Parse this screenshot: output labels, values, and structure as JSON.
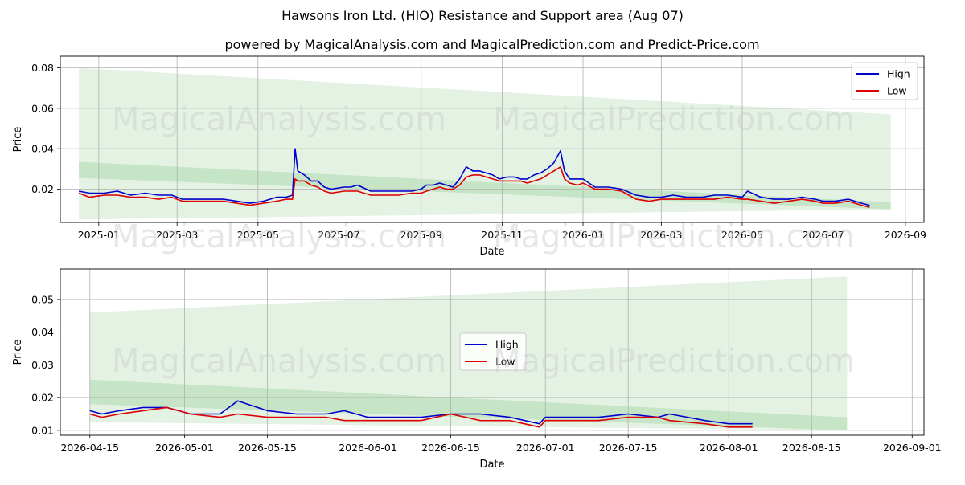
{
  "title": "Hawsons Iron Ltd. (HIO) Resistance and Support area (Aug 07)",
  "subtitle": "powered by MagicalAnalysis.com and MagicalPrediction.com and Predict-Price.com",
  "watermarks": [
    "MagicalAnalysis.com",
    "MagicalPrediction.com"
  ],
  "colors": {
    "high": "#0000cc",
    "low": "#dd0000",
    "band": "#2e9b2e",
    "grid": "#b0b0b0"
  },
  "chart_data": [
    {
      "type": "line",
      "xlabel": "Date",
      "ylabel": "Price",
      "xlim": [
        "2024-12-03",
        "2026-09-15"
      ],
      "ylim": [
        0.0035,
        0.0858
      ],
      "xticks": [
        "2025-01",
        "2025-03",
        "2025-05",
        "2025-07",
        "2025-09",
        "2025-11",
        "2026-01",
        "2026-03",
        "2026-05",
        "2026-07",
        "2026-09"
      ],
      "xtick_dates": [
        "2025-01-01",
        "2025-03-01",
        "2025-05-01",
        "2025-07-01",
        "2025-09-01",
        "2025-11-01",
        "2026-01-01",
        "2026-03-01",
        "2026-05-01",
        "2026-07-01",
        "2026-09-01"
      ],
      "yticks": [
        "0.02",
        "0.04",
        "0.06",
        "0.08"
      ],
      "grid": true,
      "legend": {
        "position": "top-right",
        "entries": [
          "High",
          "Low"
        ]
      },
      "bands": [
        {
          "x": [
            "2024-12-17",
            "2026-08-21"
          ],
          "upper": [
            0.08,
            0.057
          ],
          "lower": [
            0.005,
            0.01
          ]
        },
        {
          "x": [
            "2024-12-17",
            "2026-08-21"
          ],
          "upper": [
            0.0335,
            0.0135
          ],
          "lower": [
            0.0255,
            0.01
          ]
        }
      ],
      "series": [
        {
          "name": "High",
          "x": [
            "2024-12-17",
            "2024-12-25",
            "2025-01-05",
            "2025-01-15",
            "2025-01-25",
            "2025-02-05",
            "2025-02-15",
            "2025-02-25",
            "2025-03-05",
            "2025-03-15",
            "2025-03-25",
            "2025-04-05",
            "2025-04-15",
            "2025-04-25",
            "2025-05-05",
            "2025-05-15",
            "2025-05-22",
            "2025-05-27",
            "2025-05-29",
            "2025-05-31",
            "2025-06-05",
            "2025-06-10",
            "2025-06-15",
            "2025-06-20",
            "2025-06-25",
            "2025-07-05",
            "2025-07-10",
            "2025-07-15",
            "2025-07-25",
            "2025-08-05",
            "2025-08-15",
            "2025-08-25",
            "2025-09-01",
            "2025-09-05",
            "2025-09-10",
            "2025-09-15",
            "2025-09-20",
            "2025-09-25",
            "2025-09-30",
            "2025-10-05",
            "2025-10-10",
            "2025-10-15",
            "2025-10-20",
            "2025-10-25",
            "2025-10-30",
            "2025-11-05",
            "2025-11-10",
            "2025-11-15",
            "2025-11-20",
            "2025-11-25",
            "2025-11-30",
            "2025-12-05",
            "2025-12-10",
            "2025-12-15",
            "2025-12-18",
            "2025-12-22",
            "2025-12-28",
            "2026-01-01",
            "2026-01-10",
            "2026-01-20",
            "2026-01-30",
            "2026-02-10",
            "2026-02-20",
            "2026-03-01",
            "2026-03-10",
            "2026-03-20",
            "2026-04-01",
            "2026-04-10",
            "2026-04-20",
            "2026-05-01",
            "2026-05-05",
            "2026-05-15",
            "2026-05-25",
            "2026-06-05",
            "2026-06-15",
            "2026-06-25",
            "2026-07-01",
            "2026-07-10",
            "2026-07-20",
            "2026-07-30",
            "2026-08-05"
          ],
          "values": [
            0.019,
            0.018,
            0.018,
            0.019,
            0.017,
            0.018,
            0.017,
            0.017,
            0.015,
            0.015,
            0.015,
            0.015,
            0.014,
            0.013,
            0.014,
            0.016,
            0.016,
            0.017,
            0.04,
            0.029,
            0.027,
            0.024,
            0.024,
            0.021,
            0.02,
            0.021,
            0.021,
            0.022,
            0.019,
            0.019,
            0.019,
            0.019,
            0.02,
            0.022,
            0.022,
            0.023,
            0.022,
            0.021,
            0.025,
            0.031,
            0.029,
            0.029,
            0.028,
            0.027,
            0.025,
            0.026,
            0.026,
            0.025,
            0.025,
            0.027,
            0.028,
            0.03,
            0.033,
            0.039,
            0.029,
            0.025,
            0.025,
            0.025,
            0.021,
            0.021,
            0.02,
            0.017,
            0.016,
            0.016,
            0.017,
            0.016,
            0.016,
            0.017,
            0.017,
            0.016,
            0.019,
            0.016,
            0.015,
            0.015,
            0.016,
            0.015,
            0.014,
            0.014,
            0.015,
            0.013,
            0.012
          ]
        },
        {
          "name": "Low",
          "x": [
            "2024-12-17",
            "2024-12-25",
            "2025-01-05",
            "2025-01-15",
            "2025-01-25",
            "2025-02-05",
            "2025-02-15",
            "2025-02-25",
            "2025-03-05",
            "2025-03-15",
            "2025-03-25",
            "2025-04-05",
            "2025-04-15",
            "2025-04-25",
            "2025-05-05",
            "2025-05-15",
            "2025-05-22",
            "2025-05-27",
            "2025-05-29",
            "2025-05-31",
            "2025-06-05",
            "2025-06-10",
            "2025-06-15",
            "2025-06-20",
            "2025-06-25",
            "2025-07-05",
            "2025-07-10",
            "2025-07-15",
            "2025-07-25",
            "2025-08-05",
            "2025-08-15",
            "2025-08-25",
            "2025-09-01",
            "2025-09-05",
            "2025-09-10",
            "2025-09-15",
            "2025-09-20",
            "2025-09-25",
            "2025-09-30",
            "2025-10-05",
            "2025-10-10",
            "2025-10-15",
            "2025-10-20",
            "2025-10-25",
            "2025-10-30",
            "2025-11-05",
            "2025-11-10",
            "2025-11-15",
            "2025-11-20",
            "2025-11-25",
            "2025-11-30",
            "2025-12-05",
            "2025-12-10",
            "2025-12-15",
            "2025-12-18",
            "2025-12-22",
            "2025-12-28",
            "2026-01-01",
            "2026-01-10",
            "2026-01-20",
            "2026-01-30",
            "2026-02-10",
            "2026-02-20",
            "2026-03-01",
            "2026-03-10",
            "2026-03-20",
            "2026-04-01",
            "2026-04-10",
            "2026-04-20",
            "2026-05-01",
            "2026-05-05",
            "2026-05-15",
            "2026-05-25",
            "2026-06-05",
            "2026-06-15",
            "2026-06-25",
            "2026-07-01",
            "2026-07-10",
            "2026-07-20",
            "2026-07-30",
            "2026-08-05"
          ],
          "values": [
            0.018,
            0.016,
            0.017,
            0.017,
            0.016,
            0.016,
            0.015,
            0.016,
            0.014,
            0.014,
            0.014,
            0.014,
            0.013,
            0.012,
            0.013,
            0.014,
            0.015,
            0.015,
            0.025,
            0.024,
            0.024,
            0.022,
            0.021,
            0.019,
            0.018,
            0.019,
            0.019,
            0.019,
            0.017,
            0.017,
            0.017,
            0.018,
            0.018,
            0.019,
            0.02,
            0.021,
            0.02,
            0.02,
            0.022,
            0.026,
            0.027,
            0.027,
            0.026,
            0.025,
            0.024,
            0.024,
            0.024,
            0.024,
            0.023,
            0.024,
            0.025,
            0.027,
            0.029,
            0.031,
            0.025,
            0.023,
            0.022,
            0.023,
            0.02,
            0.02,
            0.019,
            0.015,
            0.014,
            0.015,
            0.015,
            0.015,
            0.015,
            0.015,
            0.016,
            0.015,
            0.015,
            0.014,
            0.013,
            0.014,
            0.015,
            0.014,
            0.013,
            0.013,
            0.014,
            0.012,
            0.011
          ]
        }
      ]
    },
    {
      "type": "line",
      "xlabel": "Date",
      "ylabel": "Price",
      "xlim": [
        "2026-04-10",
        "2026-09-03"
      ],
      "ylim": [
        0.0085,
        0.0593
      ],
      "xticks": [
        "2026-04-15",
        "2026-05-01",
        "2026-05-15",
        "2026-06-01",
        "2026-06-15",
        "2026-07-01",
        "2026-07-15",
        "2026-08-01",
        "2026-08-15",
        "2026-09-01"
      ],
      "yticks": [
        "0.01",
        "0.02",
        "0.03",
        "0.04",
        "0.05"
      ],
      "grid": true,
      "legend": {
        "position": "center-left",
        "entries": [
          "High",
          "Low"
        ]
      },
      "bands": [
        {
          "x": [
            "2026-04-15",
            "2026-08-21"
          ],
          "upper": [
            0.046,
            0.057
          ],
          "lower": [
            0.0125,
            0.01
          ]
        },
        {
          "x": [
            "2026-04-15",
            "2026-08-21"
          ],
          "upper": [
            0.0255,
            0.014
          ],
          "lower": [
            0.018,
            0.01
          ]
        }
      ],
      "series": [
        {
          "name": "High",
          "x": [
            "2026-04-15",
            "2026-04-17",
            "2026-04-20",
            "2026-04-24",
            "2026-04-28",
            "2026-05-02",
            "2026-05-07",
            "2026-05-10",
            "2026-05-15",
            "2026-05-20",
            "2026-05-25",
            "2026-05-28",
            "2026-06-01",
            "2026-06-05",
            "2026-06-10",
            "2026-06-15",
            "2026-06-20",
            "2026-06-25",
            "2026-06-30",
            "2026-07-01",
            "2026-07-10",
            "2026-07-15",
            "2026-07-20",
            "2026-07-22",
            "2026-07-28",
            "2026-08-01",
            "2026-08-05"
          ],
          "values": [
            0.016,
            0.015,
            0.016,
            0.017,
            0.017,
            0.015,
            0.015,
            0.019,
            0.016,
            0.015,
            0.015,
            0.016,
            0.014,
            0.014,
            0.014,
            0.015,
            0.015,
            0.014,
            0.012,
            0.014,
            0.014,
            0.015,
            0.014,
            0.015,
            0.013,
            0.012,
            0.012
          ]
        },
        {
          "name": "Low",
          "x": [
            "2026-04-15",
            "2026-04-17",
            "2026-04-20",
            "2026-04-24",
            "2026-04-28",
            "2026-05-02",
            "2026-05-07",
            "2026-05-10",
            "2026-05-15",
            "2026-05-20",
            "2026-05-25",
            "2026-05-28",
            "2026-06-01",
            "2026-06-05",
            "2026-06-10",
            "2026-06-15",
            "2026-06-20",
            "2026-06-25",
            "2026-06-30",
            "2026-07-01",
            "2026-07-10",
            "2026-07-15",
            "2026-07-20",
            "2026-07-22",
            "2026-07-28",
            "2026-08-01",
            "2026-08-05"
          ],
          "values": [
            0.015,
            0.014,
            0.015,
            0.016,
            0.017,
            0.015,
            0.014,
            0.015,
            0.014,
            0.014,
            0.014,
            0.013,
            0.013,
            0.013,
            0.013,
            0.015,
            0.013,
            0.013,
            0.011,
            0.013,
            0.013,
            0.014,
            0.014,
            0.013,
            0.012,
            0.011,
            0.011
          ]
        }
      ]
    }
  ]
}
